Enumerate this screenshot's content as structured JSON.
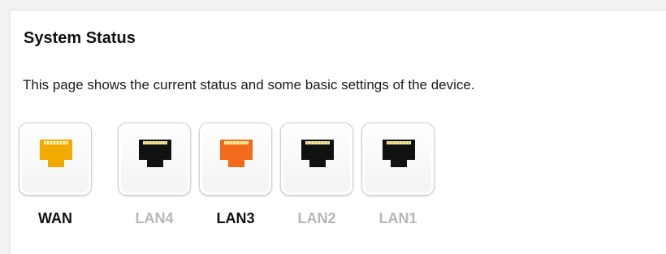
{
  "page": {
    "title": "System Status",
    "description": "This page shows the current status and some basic settings of the device."
  },
  "ports": [
    {
      "label": "WAN",
      "color": "#f2a900",
      "active": true
    },
    {
      "label": "LAN4",
      "color": "#111111",
      "active": false
    },
    {
      "label": "LAN3",
      "color": "#f26a1b",
      "active": true
    },
    {
      "label": "LAN2",
      "color": "#111111",
      "active": false
    },
    {
      "label": "LAN1",
      "color": "#111111",
      "active": false
    }
  ],
  "icons": {
    "port_icon": "ethernet-port-icon"
  }
}
